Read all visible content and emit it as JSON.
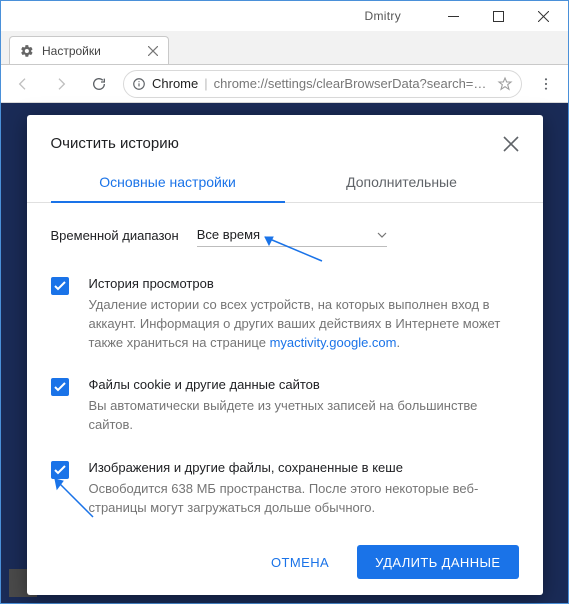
{
  "window": {
    "user": "Dmitry"
  },
  "browser_tab": {
    "title": "Настройки"
  },
  "omnibox": {
    "scheme": "Chrome",
    "url": "chrome://settings/clearBrowserData?search=очи…"
  },
  "dialog": {
    "title": "Очистить историю",
    "tabs": {
      "basic": "Основные настройки",
      "advanced": "Дополнительные"
    },
    "range": {
      "label": "Временной диапазон",
      "value": "Все время"
    },
    "options": [
      {
        "title": "История просмотров",
        "desc_before": "Удаление истории со всех устройств, на которых выполнен вход в аккаунт. Информация о других ваших действиях в Интернете может также храниться на странице ",
        "link": "myactivity.google.com",
        "desc_after": "."
      },
      {
        "title": "Файлы cookie и другие данные сайтов",
        "desc": "Вы автоматически выйдете из учетных записей на большинстве сайтов."
      },
      {
        "title": "Изображения и другие файлы, сохраненные в кеше",
        "desc": "Освободится 638 МБ пространства. После этого некоторые веб-страницы могут загружаться дольше обычного."
      }
    ],
    "actions": {
      "cancel": "ОТМЕНА",
      "confirm": "УДАЛИТЬ ДАННЫЕ"
    }
  }
}
